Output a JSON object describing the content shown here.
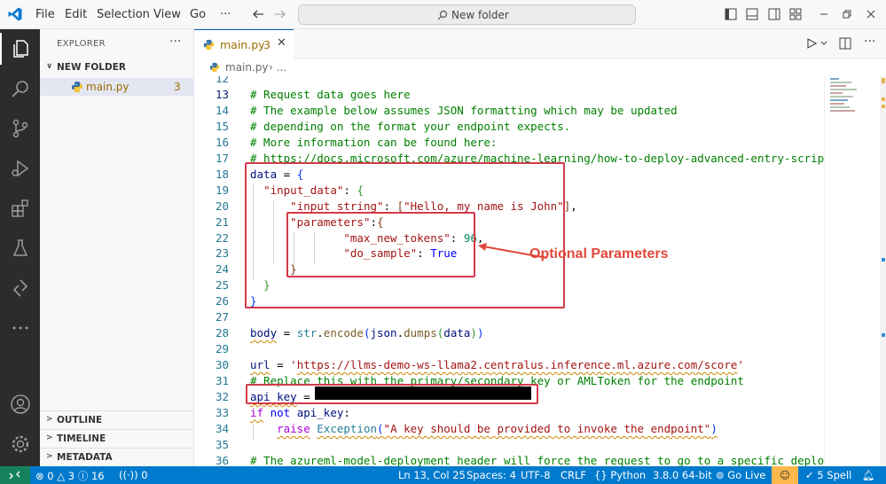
{
  "menu": [
    "File",
    "Edit",
    "Selection",
    "View",
    "Go",
    "···"
  ],
  "search": {
    "label": "New folder"
  },
  "explorer": {
    "title": "EXPLORER",
    "more": "···",
    "folder": "NEW FOLDER",
    "file": {
      "name": "main.py",
      "problems": "3"
    },
    "sections": [
      "OUTLINE",
      "TIMELINE",
      "METADATA"
    ]
  },
  "tab": {
    "name": "main.py",
    "problems": "3",
    "close": "✕"
  },
  "breadcrumb": {
    "file": "main.py",
    "rest": "..."
  },
  "editor": {
    "lines": [
      {
        "n": "12",
        "segs": [
          {
            "c": "cmt",
            "t": ""
          }
        ]
      },
      {
        "n": "13",
        "segs": [
          {
            "c": "cmt",
            "t": "# Request data goes here"
          }
        ]
      },
      {
        "n": "14",
        "segs": [
          {
            "c": "cmt",
            "t": "# The example below assumes JSON formatting which may be updated"
          }
        ]
      },
      {
        "n": "15",
        "segs": [
          {
            "c": "cmt",
            "t": "# depending on the format your endpoint expects."
          }
        ]
      },
      {
        "n": "16",
        "segs": [
          {
            "c": "cmt",
            "t": "# More information can be found here:"
          }
        ]
      },
      {
        "n": "17",
        "segs": [
          {
            "c": "cmt",
            "t": "# https://docs.microsoft.com/azure/machine-learning/how-to-deploy-advanced-entry-script"
          }
        ]
      },
      {
        "n": "18",
        "segs": [
          {
            "c": "var",
            "t": "data"
          },
          {
            "c": "pun",
            "t": " = "
          },
          {
            "c": "b1",
            "t": "{"
          }
        ]
      },
      {
        "n": "19",
        "segs": [
          {
            "c": "pun",
            "t": "  "
          },
          {
            "c": "str",
            "t": "\"input_data\""
          },
          {
            "c": "pun",
            "t": ": "
          },
          {
            "c": "b2",
            "t": "{"
          }
        ]
      },
      {
        "n": "20",
        "segs": [
          {
            "c": "pun",
            "t": "      "
          },
          {
            "c": "str",
            "t": "\"input_string\""
          },
          {
            "c": "pun",
            "t": ": "
          },
          {
            "c": "b3",
            "t": "["
          },
          {
            "c": "str",
            "t": "\"Hello, my name is John\""
          },
          {
            "c": "b3",
            "t": "]"
          },
          {
            "c": "pun",
            "t": ","
          }
        ]
      },
      {
        "n": "21",
        "segs": [
          {
            "c": "pun",
            "t": "      "
          },
          {
            "c": "str",
            "t": "\"parameters\""
          },
          {
            "c": "pun",
            "t": ":"
          },
          {
            "c": "b3",
            "t": "{"
          }
        ]
      },
      {
        "n": "22",
        "segs": [
          {
            "c": "pun",
            "t": "              "
          },
          {
            "c": "str",
            "t": "\"max_new_tokens\""
          },
          {
            "c": "pun",
            "t": ": "
          },
          {
            "c": "num",
            "t": "96"
          },
          {
            "c": "pun",
            "t": ","
          }
        ]
      },
      {
        "n": "23",
        "segs": [
          {
            "c": "pun",
            "t": "              "
          },
          {
            "c": "str",
            "t": "\"do_sample\""
          },
          {
            "c": "pun",
            "t": ": "
          },
          {
            "c": "kw",
            "t": "True"
          }
        ]
      },
      {
        "n": "24",
        "segs": [
          {
            "c": "pun",
            "t": "      "
          },
          {
            "c": "b3",
            "t": "}"
          }
        ]
      },
      {
        "n": "25",
        "segs": [
          {
            "c": "pun",
            "t": "  "
          },
          {
            "c": "b2",
            "t": "}"
          }
        ]
      },
      {
        "n": "26",
        "segs": [
          {
            "c": "b1",
            "t": "}"
          }
        ]
      },
      {
        "n": "27",
        "segs": [
          {
            "c": "pun",
            "t": ""
          }
        ]
      },
      {
        "n": "28",
        "segs": [
          {
            "c": "var squig",
            "t": "body"
          },
          {
            "c": "pun",
            "t": " = "
          },
          {
            "c": "cls",
            "t": "str"
          },
          {
            "c": "pun",
            "t": "."
          },
          {
            "c": "fn",
            "t": "encode"
          },
          {
            "c": "b1",
            "t": "("
          },
          {
            "c": "var",
            "t": "json"
          },
          {
            "c": "pun",
            "t": "."
          },
          {
            "c": "fn",
            "t": "dumps"
          },
          {
            "c": "b2",
            "t": "("
          },
          {
            "c": "var",
            "t": "data"
          },
          {
            "c": "b2",
            "t": ")"
          },
          {
            "c": "b1",
            "t": ")"
          }
        ]
      },
      {
        "n": "29",
        "segs": [
          {
            "c": "pun",
            "t": ""
          }
        ]
      },
      {
        "n": "30",
        "segs": [
          {
            "c": "var squig",
            "t": "url"
          },
          {
            "c": "pun",
            "t": " = "
          },
          {
            "c": "str",
            "t": "'"
          },
          {
            "c": "str squig",
            "t": "https://llms-demo-ws-llama2.centralus.inference.ml.azure.com/score"
          },
          {
            "c": "str",
            "t": "'"
          }
        ]
      },
      {
        "n": "31",
        "segs": [
          {
            "c": "cmt",
            "t": "# Replace this with the primary/secondary key or AMLToken for the endpoint"
          }
        ]
      },
      {
        "n": "32",
        "segs": [
          {
            "c": "var squig",
            "t": "api_key"
          },
          {
            "c": "pun",
            "t": " = "
          }
        ]
      },
      {
        "n": "33",
        "segs": [
          {
            "c": "kwc squig",
            "t": "if"
          },
          {
            "c": "pun",
            "t": " "
          },
          {
            "c": "kw",
            "t": "not"
          },
          {
            "c": "pun",
            "t": " "
          },
          {
            "c": "var",
            "t": "api_key"
          },
          {
            "c": "pun",
            "t": ":"
          }
        ]
      },
      {
        "n": "34",
        "segs": [
          {
            "c": "pun",
            "t": "    "
          },
          {
            "c": "kwc squig",
            "t": "raise"
          },
          {
            "c": "pun",
            "t": " "
          },
          {
            "c": "cls squig",
            "t": "Exception"
          },
          {
            "c": "b1 squig",
            "t": "("
          },
          {
            "c": "str squig",
            "t": "\"A key should be provided to invoke the endpoint\""
          },
          {
            "c": "b1 squig",
            "t": ")"
          }
        ]
      },
      {
        "n": "35",
        "segs": [
          {
            "c": "pun",
            "t": ""
          }
        ]
      },
      {
        "n": "36",
        "segs": [
          {
            "c": "cmt",
            "t": "# The azureml-model-deployment header will force the request to go to a specific deploymen"
          }
        ]
      }
    ],
    "annotation": "Optional Parameters"
  },
  "status": {
    "errors": "0",
    "warnings": "3",
    "info": "16",
    "ports": "0",
    "position": "Ln 13, Col 25",
    "spaces": "Spaces: 4",
    "encoding": "UTF-8",
    "eol": "CRLF",
    "language": "Python",
    "interpreter": "3.8.0 64-bit",
    "golive": "Go Live",
    "spell": "5 Spell"
  },
  "colors": {
    "accent": "#007acc",
    "annotation": "#e0483a",
    "activitybar": "#2c2c2c"
  }
}
